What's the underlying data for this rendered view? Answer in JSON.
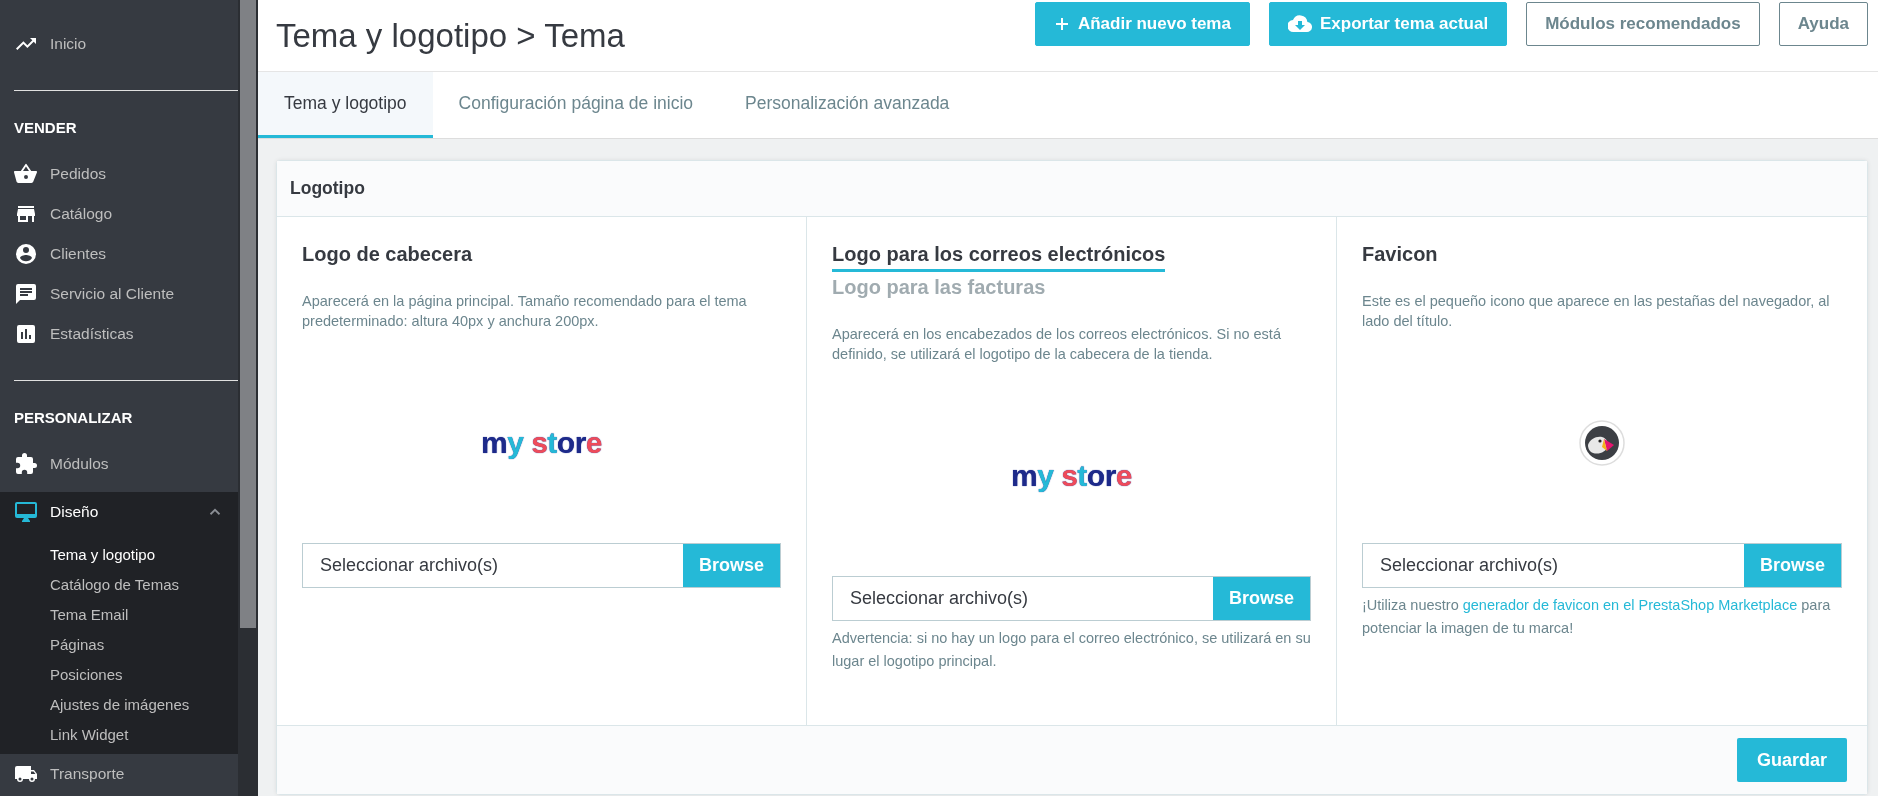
{
  "sidebar": {
    "items": [
      {
        "kind": "item",
        "label": "Inicio",
        "selected": false
      },
      {
        "kind": "divider"
      },
      {
        "kind": "heading",
        "label": "VENDER"
      },
      {
        "kind": "item",
        "label": "Pedidos",
        "selected": false
      },
      {
        "kind": "item",
        "label": "Catálogo",
        "selected": false
      },
      {
        "kind": "item",
        "label": "Clientes",
        "selected": false
      },
      {
        "kind": "item",
        "label": "Servicio al Cliente",
        "selected": false
      },
      {
        "kind": "item",
        "label": "Estadísticas",
        "selected": false
      },
      {
        "kind": "divider"
      },
      {
        "kind": "heading",
        "label": "PERSONALIZAR"
      },
      {
        "kind": "item",
        "label": "Módulos",
        "selected": false
      },
      {
        "kind": "item",
        "label": "Diseño",
        "selected": true,
        "expanded": true,
        "children": [
          {
            "label": "Tema y logotipo",
            "selected": true
          },
          {
            "label": "Catálogo de Temas",
            "selected": false
          },
          {
            "label": "Tema Email",
            "selected": false
          },
          {
            "label": "Páginas",
            "selected": false
          },
          {
            "label": "Posiciones",
            "selected": false
          },
          {
            "label": "Ajustes de imágenes",
            "selected": false
          },
          {
            "label": "Link Widget",
            "selected": false
          }
        ]
      },
      {
        "kind": "item",
        "label": "Transporte",
        "selected": false
      }
    ]
  },
  "header": {
    "title": "Tema y logotipo > Tema",
    "buttons": [
      {
        "kind": "primary",
        "label": "Añadir nuevo tema"
      },
      {
        "kind": "primary",
        "label": "Exportar tema actual"
      },
      {
        "kind": "outline",
        "label": "Módulos recomendados"
      },
      {
        "kind": "outline",
        "label": "Ayuda"
      }
    ]
  },
  "tabs": [
    {
      "label": "Tema y logotipo",
      "selected": true
    },
    {
      "label": "Configuración página de inicio",
      "selected": false
    },
    {
      "label": "Personalización avanzada",
      "selected": false
    }
  ],
  "panel": {
    "title": "Logotipo",
    "columns": [
      {
        "titles": [
          {
            "label": "Logo de cabecera",
            "selected": false
          }
        ],
        "description": "Aparecerá en la página principal. Tamaño recomendado para el tema predeterminado: altura 40px y anchura 200px.",
        "kind": "logo",
        "logo_text": "my store",
        "file_placeholder": "Seleccionar archivo(s)",
        "browse": "Browse"
      },
      {
        "titles": [
          {
            "label": "Logo para los correos electrónicos",
            "selected": true
          },
          {
            "label": "Logo para las facturas",
            "selected": false
          }
        ],
        "description": "Aparecerá en los encabezados de los correos electrónicos. Si no está definido, se utilizará el logotipo de la cabecera de la tienda.",
        "kind": "logo",
        "logo_text": "my store",
        "file_placeholder": "Seleccionar archivo(s)",
        "browse": "Browse",
        "note": "Advertencia: si no hay un logo para el correo electrónico, se utilizará en su lugar el logotipo principal."
      },
      {
        "titles": [
          {
            "label": "Favicon",
            "selected": false
          }
        ],
        "description": "Este es el pequeño icono que aparece en las pestañas del navegador, al lado del título.",
        "kind": "favicon",
        "file_placeholder": "Seleccionar archivo(s)",
        "browse": "Browse",
        "help": {
          "before": "¡Utiliza nuestro ",
          "link": "generador de favicon en el PrestaShop Marketplace",
          "after": " para potenciar la imagen de tu marca!"
        }
      }
    ],
    "save": "Guardar"
  }
}
